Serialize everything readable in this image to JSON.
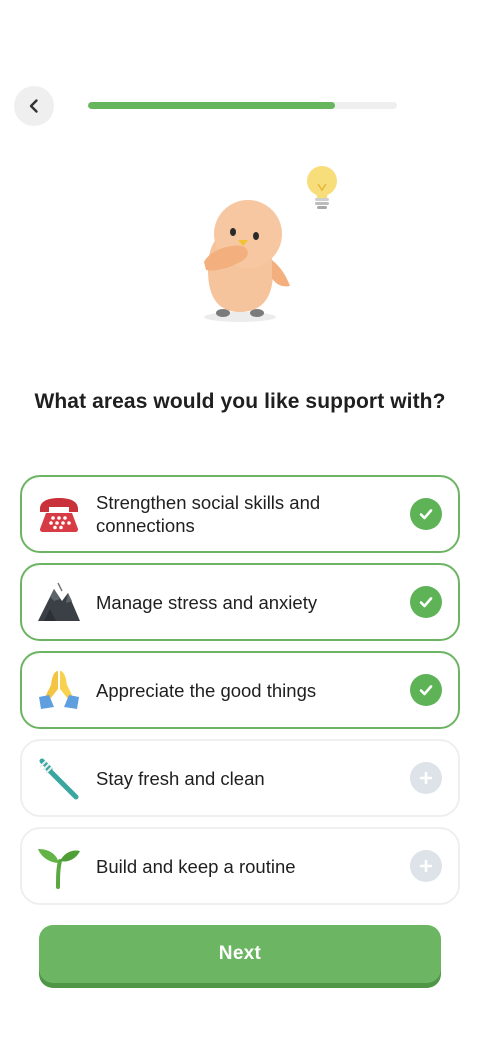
{
  "header": {
    "back_icon": "chevron-left-icon",
    "progress_fraction": 0.8
  },
  "mascot": {
    "icon": "mascot-thinking-icon",
    "bulb_icon": "lightbulb-icon"
  },
  "question": "What areas would you like support with?",
  "options": [
    {
      "label": "Strengthen social skills and connections",
      "icon": "telephone-icon",
      "selected": true
    },
    {
      "label": "Manage stress and anxiety",
      "icon": "mountain-icon",
      "selected": true
    },
    {
      "label": "Appreciate the good things",
      "icon": "folded-hands-icon",
      "selected": true
    },
    {
      "label": "Stay fresh and clean",
      "icon": "toothbrush-icon",
      "selected": false
    },
    {
      "label": "Build and keep a routine",
      "icon": "seedling-icon",
      "selected": false
    }
  ],
  "next_label": "Next",
  "colors": {
    "accent": "#67b55c",
    "selected_border": "#6cb463",
    "unselected_check": "#dde3e8"
  }
}
